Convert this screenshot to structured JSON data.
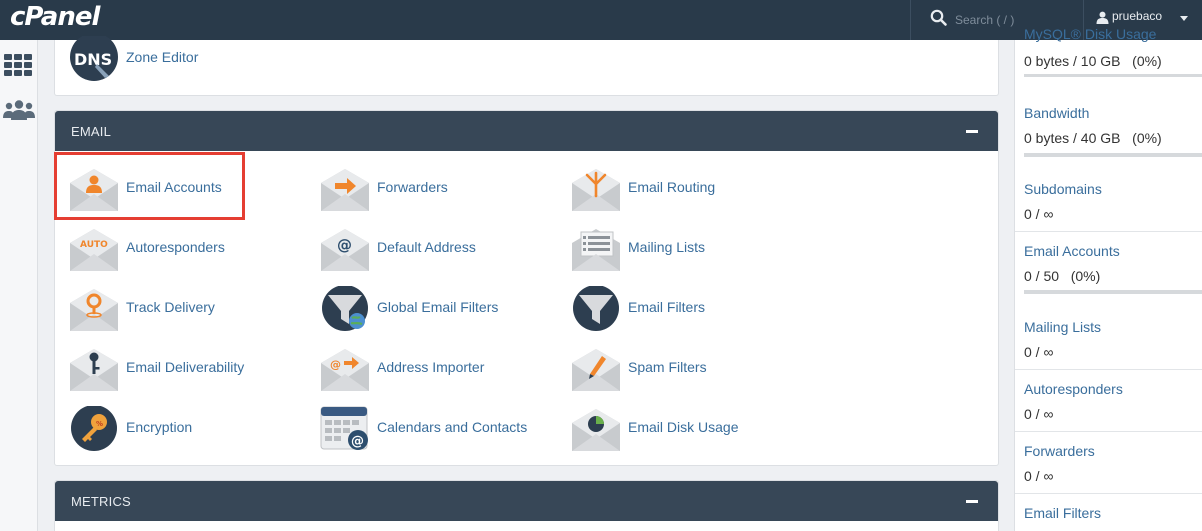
{
  "app": {
    "logo_text": "cPanel"
  },
  "topbar": {
    "search_placeholder": "Search ( / )",
    "username": "pruebaco"
  },
  "leftrail": {
    "items": [
      {
        "icon": "grid-icon"
      },
      {
        "icon": "users-icon"
      }
    ]
  },
  "colors": {
    "topbar": "#293a4a",
    "panel_header": "#374757",
    "link": "#3a6e9c",
    "highlight": "#e53e32",
    "accent_orange": "#f0862c"
  },
  "top_panel": {
    "tools": [
      {
        "label": "Zone Editor",
        "icon": "dns-icon"
      }
    ]
  },
  "email_panel": {
    "title": "EMAIL",
    "tools": [
      {
        "label": "Email Accounts",
        "icon": "email-accounts-icon"
      },
      {
        "label": "Forwarders",
        "icon": "forwarders-icon"
      },
      {
        "label": "Email Routing",
        "icon": "email-routing-icon"
      },
      {
        "label": "Autoresponders",
        "icon": "autoresponders-icon",
        "badge": "AUTO"
      },
      {
        "label": "Default Address",
        "icon": "default-address-icon"
      },
      {
        "label": "Mailing Lists",
        "icon": "mailing-lists-icon"
      },
      {
        "label": "Track Delivery",
        "icon": "track-delivery-icon"
      },
      {
        "label": "Global Email Filters",
        "icon": "global-email-filters-icon"
      },
      {
        "label": "Email Filters",
        "icon": "email-filters-icon"
      },
      {
        "label": "Email Deliverability",
        "icon": "email-deliverability-icon"
      },
      {
        "label": "Address Importer",
        "icon": "address-importer-icon"
      },
      {
        "label": "Spam Filters",
        "icon": "spam-filters-icon"
      },
      {
        "label": "Encryption",
        "icon": "encryption-icon"
      },
      {
        "label": "Calendars and Contacts",
        "icon": "calendars-contacts-icon"
      },
      {
        "label": "Email Disk Usage",
        "icon": "email-disk-usage-icon"
      }
    ]
  },
  "metrics_panel": {
    "title": "METRICS"
  },
  "stats": {
    "items": [
      {
        "label": "MySQL® Disk Usage",
        "value": "0 bytes / 10 GB   (0%)",
        "bar": 0
      },
      {
        "label": "Bandwidth",
        "value": "0 bytes / 40 GB   (0%)",
        "bar": 0
      },
      {
        "label": "Subdomains",
        "value": "0 / ∞"
      },
      {
        "label": "Email Accounts",
        "value": "0 / 50   (0%)",
        "bar": 0
      },
      {
        "label": "Mailing Lists",
        "value": "0 / ∞"
      },
      {
        "label": "Autoresponders",
        "value": "0 / ∞"
      },
      {
        "label": "Forwarders",
        "value": "0 / ∞"
      },
      {
        "label": "Email Filters",
        "value": ""
      }
    ]
  }
}
